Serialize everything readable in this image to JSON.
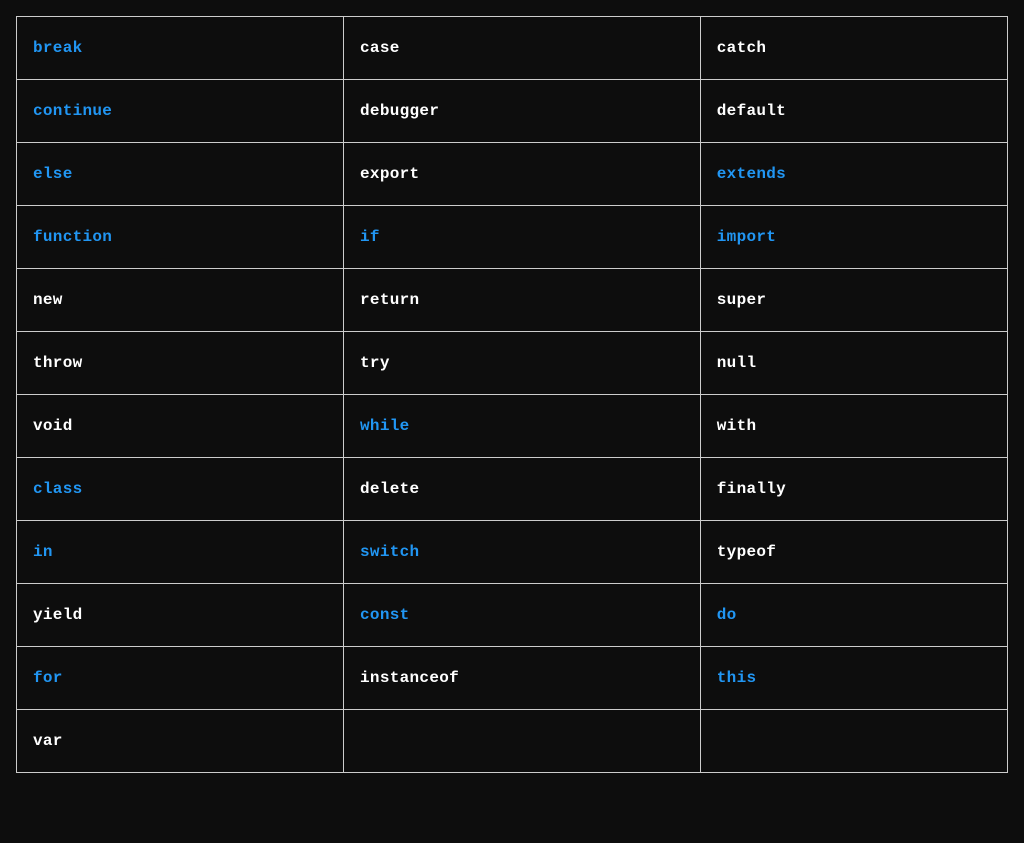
{
  "table": {
    "rows": [
      [
        {
          "text": "break",
          "link": true
        },
        {
          "text": "case",
          "link": false
        },
        {
          "text": "catch",
          "link": false
        }
      ],
      [
        {
          "text": "continue",
          "link": true
        },
        {
          "text": "debugger",
          "link": false
        },
        {
          "text": "default",
          "link": false
        }
      ],
      [
        {
          "text": "else",
          "link": true
        },
        {
          "text": "export",
          "link": false
        },
        {
          "text": "extends",
          "link": true
        }
      ],
      [
        {
          "text": "function",
          "link": true
        },
        {
          "text": "if",
          "link": true
        },
        {
          "text": "import",
          "link": true
        }
      ],
      [
        {
          "text": "new",
          "link": false
        },
        {
          "text": "return",
          "link": false
        },
        {
          "text": "super",
          "link": false
        }
      ],
      [
        {
          "text": "throw",
          "link": false
        },
        {
          "text": "try",
          "link": false
        },
        {
          "text": "null",
          "link": false
        }
      ],
      [
        {
          "text": "void",
          "link": false
        },
        {
          "text": "while",
          "link": true
        },
        {
          "text": "with",
          "link": false
        }
      ],
      [
        {
          "text": "class",
          "link": true
        },
        {
          "text": "delete",
          "link": false
        },
        {
          "text": "finally",
          "link": false
        }
      ],
      [
        {
          "text": "in",
          "link": true
        },
        {
          "text": "switch",
          "link": true
        },
        {
          "text": "typeof",
          "link": false
        }
      ],
      [
        {
          "text": "yield",
          "link": false
        },
        {
          "text": "const",
          "link": true
        },
        {
          "text": "do",
          "link": true
        }
      ],
      [
        {
          "text": "for",
          "link": true
        },
        {
          "text": "instanceof",
          "link": false
        },
        {
          "text": "this",
          "link": true
        }
      ],
      [
        {
          "text": "var",
          "link": false
        },
        {
          "text": "",
          "link": false
        },
        {
          "text": "",
          "link": false
        }
      ]
    ]
  }
}
